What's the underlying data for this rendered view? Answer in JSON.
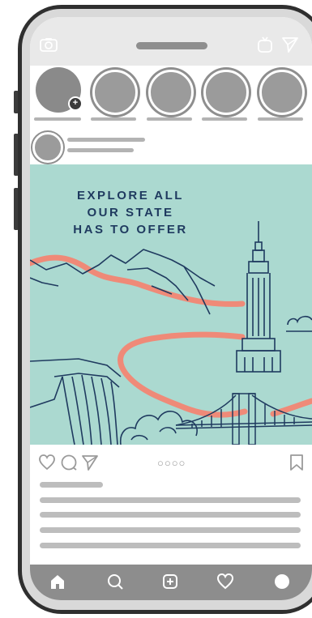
{
  "post": {
    "headline_lines": [
      "EXPLORE ALL",
      "OUR STATE",
      "HAS TO OFFER"
    ],
    "media_dots": "○○○○"
  },
  "stories": {
    "own_story_badge": "+",
    "count": 5
  },
  "icons": {
    "status_left": "camera-icon",
    "status_right": [
      "igtv-icon",
      "direct-message-icon"
    ],
    "actions": [
      "heart-icon",
      "comment-icon",
      "share-icon",
      "bookmark-icon"
    ],
    "bottom_nav": [
      "home-icon",
      "search-icon",
      "add-post-icon",
      "activity-heart-icon",
      "profile-icon"
    ]
  },
  "colors": {
    "post_background": "#abd9d0",
    "route_line": "#ef8a78",
    "illustration_ink": "#1f3a5f",
    "bottom_nav": "#8d8d8d"
  }
}
